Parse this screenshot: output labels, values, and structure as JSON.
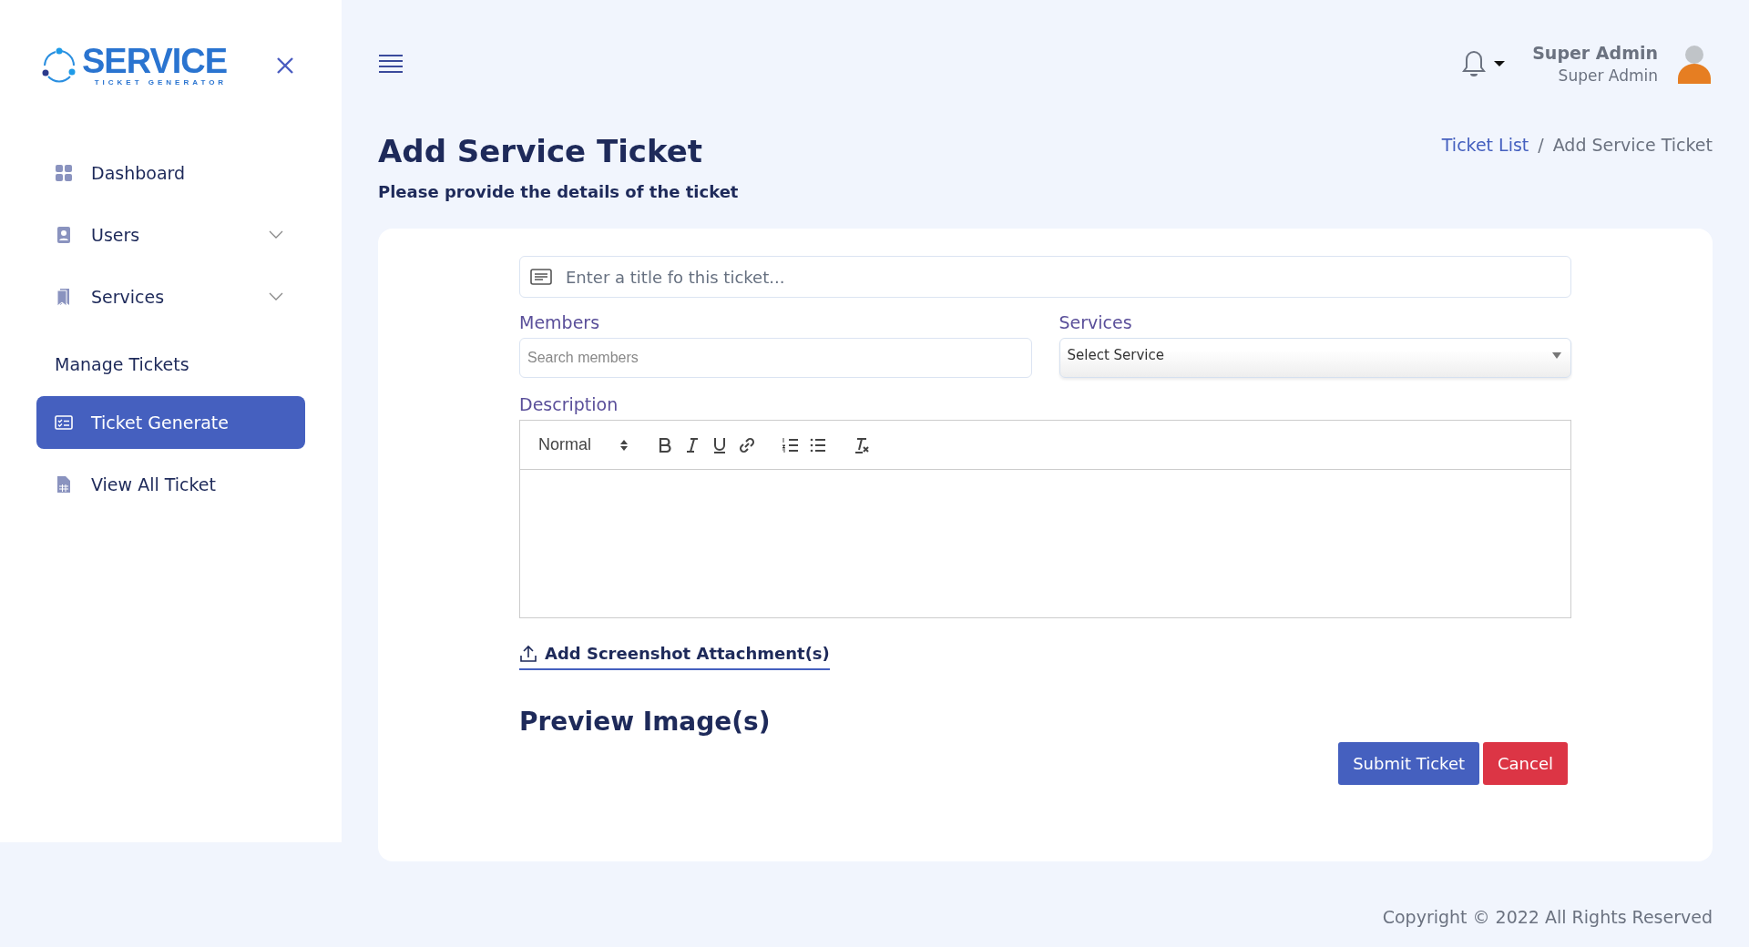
{
  "logo": {
    "title": "SERVICE",
    "subtitle": "TICKET GENERATOR"
  },
  "sidebar": {
    "items": [
      {
        "kind": "link",
        "label": "Dashboard",
        "selected": false
      },
      {
        "kind": "group",
        "label": "Users",
        "selected": false,
        "expanded": false
      },
      {
        "kind": "group",
        "label": "Services",
        "selected": false,
        "expanded": false
      },
      {
        "kind": "heading",
        "label": "Manage Tickets"
      },
      {
        "kind": "link",
        "label": "Ticket Generate",
        "selected": true
      },
      {
        "kind": "link",
        "label": "View All Ticket",
        "selected": false
      }
    ]
  },
  "user": {
    "name": "Super Admin",
    "role": "Super Admin"
  },
  "page": {
    "title": "Add Service Ticket",
    "subtitle": "Please provide the details of the ticket"
  },
  "breadcrumb": [
    {
      "label": "Ticket List",
      "kind": "link"
    },
    {
      "label": "/",
      "kind": "sep"
    },
    {
      "label": "Add Service Ticket",
      "kind": "current"
    }
  ],
  "form": {
    "title_placeholder": "Enter a title fo this ticket...",
    "members": {
      "label": "Members",
      "placeholder": "Search members"
    },
    "services": {
      "label": "Services",
      "value": "Select Service"
    },
    "description": {
      "label": "Description",
      "format": "Normal"
    },
    "attachment": "Add Screenshot Attachment(s)",
    "preview_heading": "Preview Image(s)",
    "buttons": [
      {
        "label": "Submit Ticket",
        "kind": "primary"
      },
      {
        "label": "Cancel",
        "kind": "danger"
      }
    ]
  },
  "footer": "Copyright © 2022 All Rights Reserved"
}
